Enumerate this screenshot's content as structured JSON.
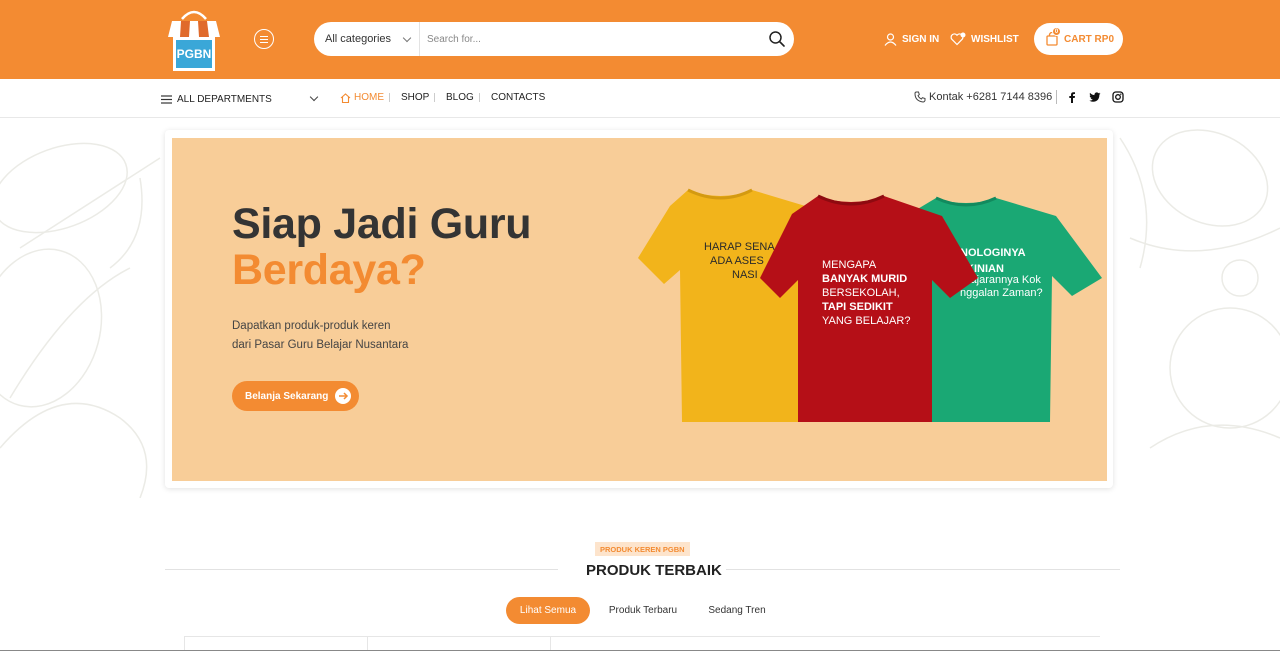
{
  "header": {
    "logo_text": "PGBN",
    "search": {
      "category": "All categories",
      "placeholder": "Search for..."
    },
    "signin_label": "SIGN IN",
    "wishlist_label": "WISHLIST",
    "cart_label": "CART RP0",
    "cart_count": "0",
    "brand_color": "#f38b32"
  },
  "nav": {
    "departments_label": "ALL DEPARTMENTS",
    "items": [
      {
        "label": "HOME",
        "active": true
      },
      {
        "label": "SHOP"
      },
      {
        "label": "BLOG"
      },
      {
        "label": "CONTACTS"
      }
    ],
    "contact_text": "Kontak +6281 7144 8396",
    "social_icons": [
      "facebook-icon",
      "twitter-icon",
      "instagram-icon"
    ]
  },
  "hero": {
    "title_line1": "Siap Jadi Guru",
    "title_line2": "Berdaya?",
    "subtitle_line1": "Dapatkan produk-produk keren",
    "subtitle_line2": "dari Pasar Guru Belajar Nusantara",
    "cta_label": "Belanja Sekarang",
    "banner_color": "#f8cd98",
    "shirt_yellow": {
      "lines": [
        "HARAP SENA",
        "ADA ASES",
        "NASI"
      ]
    },
    "shirt_red": {
      "lines": [
        "MENGAPA",
        "BANYAK MURID",
        "BERSEKOLAH,",
        "TAPI SEDIKIT",
        "YANG BELAJAR?"
      ]
    },
    "shirt_green": {
      "lines": [
        "NOLOGINYA",
        "KINIAN",
        "elajarannya Kok",
        "nggalan Zaman?"
      ]
    }
  },
  "products": {
    "eyebrow": "PRODUK KEREN PGBN",
    "title": "PRODUK TERBAIK",
    "tabs": [
      "Lihat Semua",
      "Produk Terbaru",
      "Sedang Tren"
    ]
  }
}
